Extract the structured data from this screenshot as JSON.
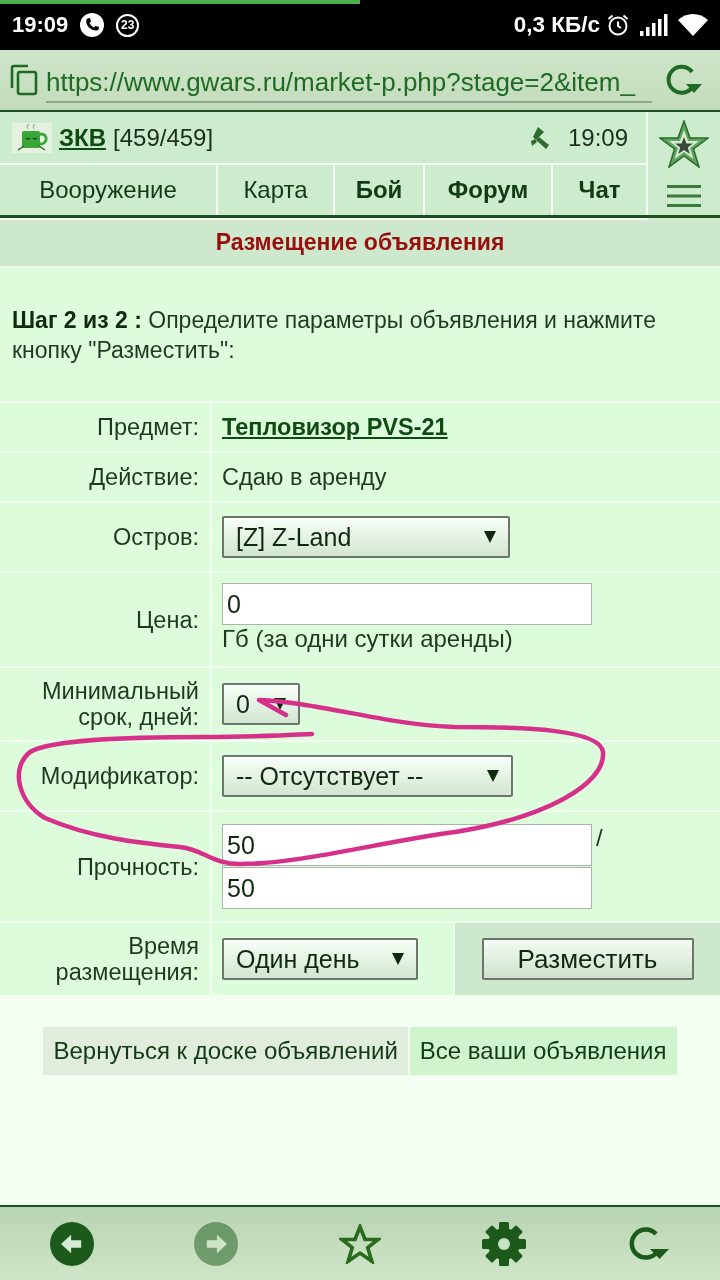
{
  "status_bar": {
    "load_progress": {
      "level": 0.5
    },
    "time": "19:09",
    "notification_count": "23",
    "network_speed": "0,3 КБ/с"
  },
  "address_bar": {
    "url": "https://www.gwars.ru/market-p.php?stage=2&item_"
  },
  "header": {
    "player_name": "ЗКВ",
    "health": "[459/459]",
    "time": "19:09"
  },
  "nav": [
    {
      "label": "Вооружение",
      "bold": false
    },
    {
      "label": "Карта",
      "bold": false
    },
    {
      "label": "Бой",
      "bold": true
    },
    {
      "label": "Форум",
      "bold": true
    },
    {
      "label": "Чат",
      "bold": true
    }
  ],
  "form": {
    "title": "Размещение объявления",
    "intro": "**Шаг 2 из 2 :** Определите параметры объявления и нажмите кнопку \"Разместить\":",
    "fields": [
      {
        "kind": "link",
        "label": "Предмет:",
        "value": "Тепловизор PVS-21"
      },
      {
        "kind": "text",
        "label": "Действие:",
        "value": "Сдаю в аренду"
      },
      {
        "kind": "select",
        "label": "Остров:",
        "value": "[Z] Z-Land"
      },
      {
        "kind": "input",
        "label": "Цена:",
        "value": "0",
        "suffix": "Гб (за одни сутки аренды)"
      },
      {
        "kind": "select",
        "label": "Минимальный срок, дней:",
        "value": "0"
      },
      {
        "kind": "select",
        "label": "Модификатор:",
        "value": "-- Отсутствует --"
      },
      {
        "kind": "pair",
        "label": "Прочность:",
        "values": [
          "50",
          "50"
        ],
        "separator": "/"
      },
      {
        "kind": "select",
        "label": "Время размещения:",
        "value": "Один день"
      }
    ],
    "submit": "Разместить"
  },
  "links": [
    {
      "label": "Вернуться к доске объявлений",
      "selected": false
    },
    {
      "label": "Все ваши объявления",
      "selected": true
    }
  ],
  "bottom_bar": {
    "back": {
      "disabled": false
    },
    "forward": {
      "disabled": true
    }
  }
}
